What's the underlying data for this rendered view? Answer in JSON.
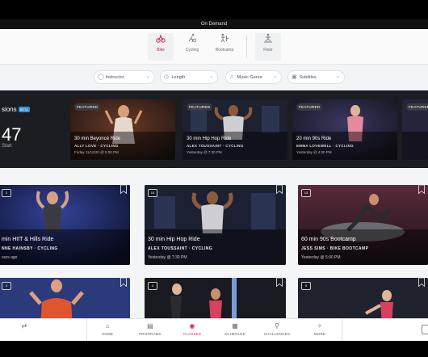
{
  "topbar": {
    "title": "On Demand"
  },
  "modes": [
    {
      "label": "Bike",
      "icon": "bike-icon",
      "active": true
    },
    {
      "label": "Cycling",
      "icon": "cycling-icon"
    },
    {
      "label": "Bootcamp",
      "icon": "bootcamp-icon"
    },
    {
      "label": "Floor",
      "icon": "floor-icon"
    }
  ],
  "filters": [
    {
      "label": "Instructor",
      "icon": "instructor-icon"
    },
    {
      "label": "Length",
      "icon": "clock-icon"
    },
    {
      "label": "Music Genre",
      "icon": "music-icon"
    },
    {
      "label": "Subtitles",
      "icon": "subtitles-icon"
    }
  ],
  "sessions": {
    "title": "sions",
    "beta": "BETA",
    "timer": "47",
    "start": "Start"
  },
  "featured": [
    {
      "badge": "FEATURED",
      "title": "30 min Beyoncé Ride",
      "instructor": "ALLY LOVE · CYCLING",
      "date": "Friday 11/12/20 @ 5:00 PM"
    },
    {
      "badge": "FEATURED",
      "title": "30 min Hip Hop Ride",
      "instructor": "ALEX TOUSSAINT · CYCLING",
      "date": "Yesterday @ 7:30 PM"
    },
    {
      "badge": "FEATURED",
      "title": "20 min 90s Ride",
      "instructor": "EMMA LOVEWELL · CYCLING",
      "date": "Yesterday @ 4:00 PM"
    },
    {
      "badge": "FEATURED",
      "title": "",
      "instructor": "",
      "date": ""
    }
  ],
  "classes": [
    {
      "count": "2",
      "title": "min HIIT & Hills Ride",
      "instructor": "NNE HAINSBY · CYCLING",
      "date": "ours ago"
    },
    {
      "count": "10",
      "title": "30 min Hip Hop Ride",
      "instructor": "ALEX TOUSSAINT · CYCLING",
      "date": "Yesterday @ 7:30 PM"
    },
    {
      "count": "13",
      "title": "60 min 90s Bootcamp",
      "instructor": "JESS SIMS · BIKE BOOTCAMP",
      "date": "Yesterday @ 5:00 PM"
    },
    {
      "count": "3",
      "title": "",
      "instructor": "",
      "date": ""
    },
    {
      "count": "4",
      "title": "",
      "instructor": "",
      "date": ""
    },
    {
      "count": "5",
      "title": "",
      "instructor": "",
      "date": ""
    }
  ],
  "nav": [
    {
      "label": "",
      "icon": "swap-icon"
    },
    {
      "label": "HOME",
      "icon": "home-icon"
    },
    {
      "label": "PROGRAMS",
      "icon": "programs-icon"
    },
    {
      "label": "CLASSES",
      "icon": "classes-icon",
      "active": true
    },
    {
      "label": "SCHEDULE",
      "icon": "schedule-icon"
    },
    {
      "label": "CHALLENGES",
      "icon": "trophy-icon"
    },
    {
      "label": "MORE",
      "icon": "more-icon"
    }
  ],
  "colors": {
    "accent": "#d0234a",
    "beta": "#3a8fd3",
    "card_dark": "#2a2c33"
  }
}
